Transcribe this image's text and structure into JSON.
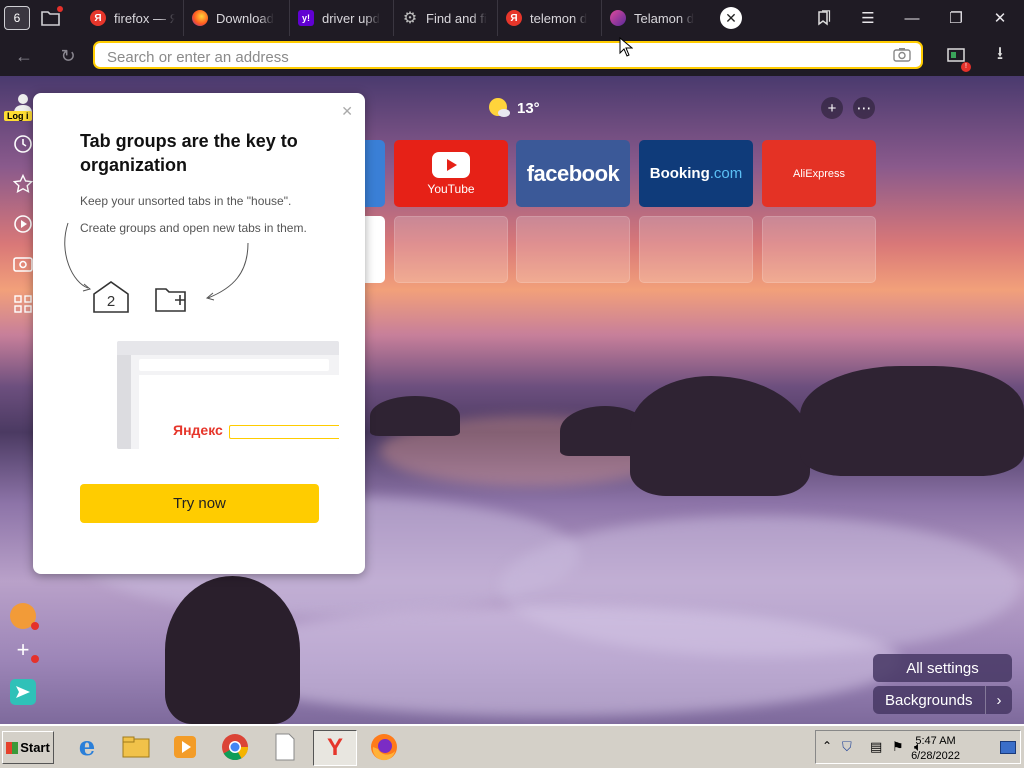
{
  "tabs": {
    "counter": "6",
    "items": [
      {
        "title": "firefox — Я",
        "favicon": "yandex-icon",
        "color": "#e6362b",
        "glyph": "Я"
      },
      {
        "title": "Download",
        "favicon": "firefox-icon",
        "color": "#ff7b1a",
        "glyph": ""
      },
      {
        "title": "driver upd",
        "favicon": "yahoo-icon",
        "color": "#6001d2",
        "glyph": "y!"
      },
      {
        "title": "Find and fi",
        "favicon": "gear-icon",
        "color": "#888888",
        "glyph": ""
      },
      {
        "title": "telemon d",
        "favicon": "yandex-icon",
        "color": "#e6362b",
        "glyph": "Я"
      },
      {
        "title": "Telamon d",
        "favicon": "telamon-icon",
        "color": "#b0308a",
        "glyph": ""
      }
    ]
  },
  "address_bar": {
    "placeholder": "Search or enter an address",
    "value": ""
  },
  "sidebar": {
    "login_label": "Log i"
  },
  "popup": {
    "title": "Tab groups are the key to organization",
    "text1": "Keep your unsorted tabs in the \"house\".",
    "text2": "Create groups and open new tabs in them.",
    "house_count": "2",
    "illustration_brand": "Яндекс",
    "button": "Try now"
  },
  "weather": {
    "temperature": "13°"
  },
  "tiles": [
    {
      "name": "YouTube",
      "label": "YouTube",
      "color": "#e62117"
    },
    {
      "name": "facebook",
      "label": "facebook",
      "color": "#3b5998"
    },
    {
      "name": "Booking",
      "label": "Booking",
      "label2": ".com",
      "color": "#0f3b7a"
    },
    {
      "name": "AliExpress",
      "label": "AliExpress",
      "color": "#e43225"
    }
  ],
  "buttons": {
    "all_settings": "All settings",
    "backgrounds": "Backgrounds"
  },
  "taskbar": {
    "start": "Start",
    "time": "5:47 AM",
    "date": "6/28/2022"
  },
  "colors": {
    "accent": "#ffcc00",
    "tabbar_bg": "#1f1b24",
    "taskbar_bg": "#d4d0c8"
  }
}
